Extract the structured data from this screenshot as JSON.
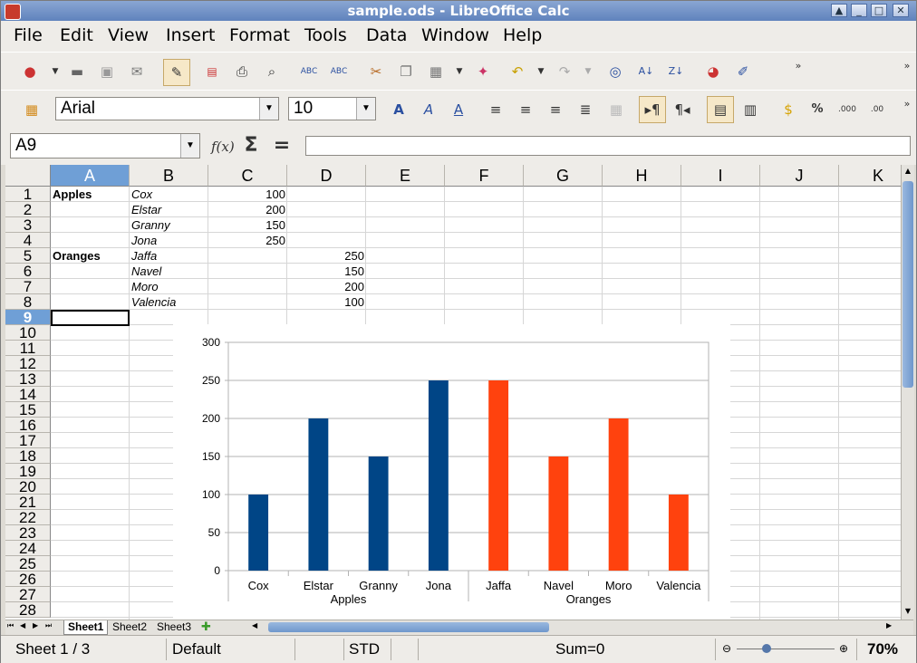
{
  "window": {
    "title": "sample.ods - LibreOffice Calc"
  },
  "menu": [
    "File",
    "Edit",
    "View",
    "Insert",
    "Format",
    "Tools",
    "Data",
    "Window",
    "Help"
  ],
  "formatting": {
    "font_name": "Arial",
    "font_size": "10"
  },
  "formula_bar": {
    "cell_ref": "A9",
    "formula": ""
  },
  "columns": [
    "A",
    "B",
    "C",
    "D",
    "E",
    "F",
    "G",
    "H",
    "I",
    "J",
    "K"
  ],
  "rows": [
    "1",
    "2",
    "3",
    "4",
    "5",
    "6",
    "7",
    "8",
    "9",
    "10",
    "11",
    "12",
    "13",
    "14",
    "15",
    "16",
    "17",
    "18",
    "19",
    "20",
    "21",
    "22",
    "23",
    "24",
    "25",
    "26",
    "27",
    "28"
  ],
  "cells": [
    {
      "col": "A",
      "row": 1,
      "text": "Apples",
      "style": "bold"
    },
    {
      "col": "B",
      "row": 1,
      "text": "Cox",
      "style": "italic"
    },
    {
      "col": "C",
      "row": 1,
      "text": "100",
      "style": "num"
    },
    {
      "col": "B",
      "row": 2,
      "text": "Elstar",
      "style": "italic"
    },
    {
      "col": "C",
      "row": 2,
      "text": "200",
      "style": "num"
    },
    {
      "col": "B",
      "row": 3,
      "text": "Granny",
      "style": "italic"
    },
    {
      "col": "C",
      "row": 3,
      "text": "150",
      "style": "num"
    },
    {
      "col": "B",
      "row": 4,
      "text": "Jona",
      "style": "italic"
    },
    {
      "col": "C",
      "row": 4,
      "text": "250",
      "style": "num"
    },
    {
      "col": "A",
      "row": 5,
      "text": "Oranges",
      "style": "bold"
    },
    {
      "col": "B",
      "row": 5,
      "text": "Jaffa",
      "style": "italic"
    },
    {
      "col": "D",
      "row": 5,
      "text": "250",
      "style": "num"
    },
    {
      "col": "B",
      "row": 6,
      "text": "Navel",
      "style": "italic"
    },
    {
      "col": "D",
      "row": 6,
      "text": "150",
      "style": "num"
    },
    {
      "col": "B",
      "row": 7,
      "text": "Moro",
      "style": "italic"
    },
    {
      "col": "D",
      "row": 7,
      "text": "200",
      "style": "num"
    },
    {
      "col": "B",
      "row": 8,
      "text": "Valencia",
      "style": "italic"
    },
    {
      "col": "D",
      "row": 8,
      "text": "100",
      "style": "num"
    }
  ],
  "chart_data": {
    "type": "bar",
    "categories": [
      "Cox",
      "Elstar",
      "Granny",
      "Jona",
      "Jaffa",
      "Navel",
      "Moro",
      "Valencia"
    ],
    "groups": [
      {
        "label": "Apples",
        "from": 0,
        "to": 3
      },
      {
        "label": "Oranges",
        "from": 4,
        "to": 7
      }
    ],
    "series": [
      {
        "values": [
          100,
          200,
          150,
          250,
          null,
          null,
          null,
          null
        ],
        "color": "#004586"
      },
      {
        "values": [
          null,
          null,
          null,
          null,
          250,
          150,
          200,
          100
        ],
        "color": "#ff420e"
      }
    ],
    "ylim": [
      0,
      300
    ],
    "yticks": [
      0,
      50,
      100,
      150,
      200,
      250,
      300
    ],
    "grid": true
  },
  "sheet_tabs": [
    "Sheet1",
    "Sheet2",
    "Sheet3"
  ],
  "status": {
    "sheet": "Sheet 1 / 3",
    "page_style": "Default",
    "mode": "STD",
    "sum": "Sum=0",
    "zoom": "70%"
  }
}
